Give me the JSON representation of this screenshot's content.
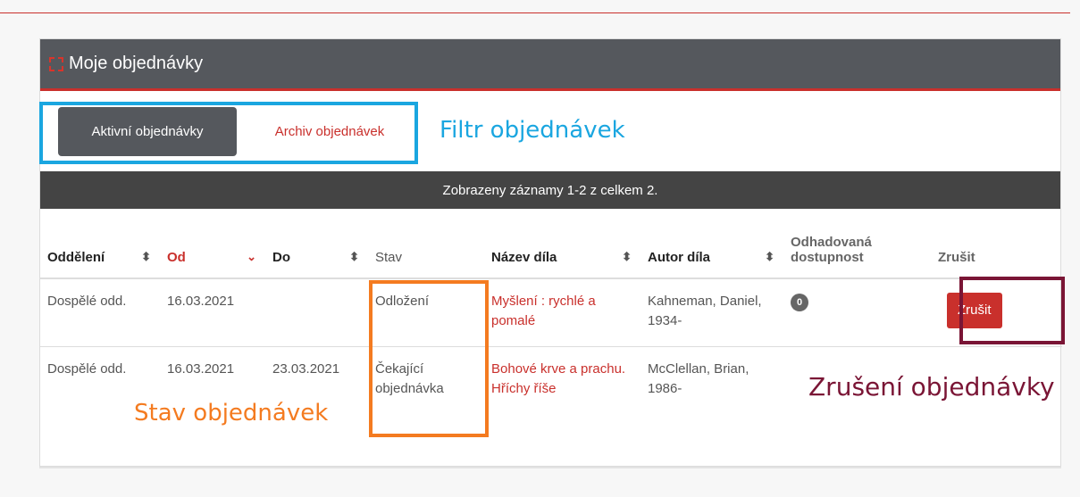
{
  "header": {
    "title": "Moje objednávky",
    "icon": "dashed-square-icon"
  },
  "filter": {
    "active_label": "Aktivní objednávky",
    "archive_label": "Archiv objednávek"
  },
  "records": {
    "text": "Zobrazeny záznamy 1-2 z celkem 2."
  },
  "columns": {
    "department": "Oddělení",
    "from": "Od",
    "to": "Do",
    "status": "Stav",
    "title": "Název díla",
    "author": "Autor díla",
    "availability": "Odhadovaná dostupnost",
    "cancel": "Zrušit"
  },
  "rows": [
    {
      "department": "Dospělé odd.",
      "from": "16.03.2021",
      "to": "",
      "status": "Odložení",
      "title": "Myšlení : rychlé a pomalé",
      "author": "Kahneman, Daniel, 1934-",
      "availability": "0",
      "cancel_label": "Zrušit"
    },
    {
      "department": "Dospělé odd.",
      "from": "16.03.2021",
      "to": "23.03.2021",
      "status": "Čekající objednávka",
      "title": "Bohové krve a prachu. Hříchy říše",
      "author": "McClellan, Brian, 1986-"
    }
  ],
  "annotations": {
    "filter": "Filtr objednávek",
    "status": "Stav objednávek",
    "cancel": "Zrušení objednávky"
  },
  "colors": {
    "accent": "#c9302c",
    "header": "#55585d",
    "filter_box": "#1aa6e0",
    "status_box": "#f47b20",
    "cancel_box": "#7a1535"
  }
}
